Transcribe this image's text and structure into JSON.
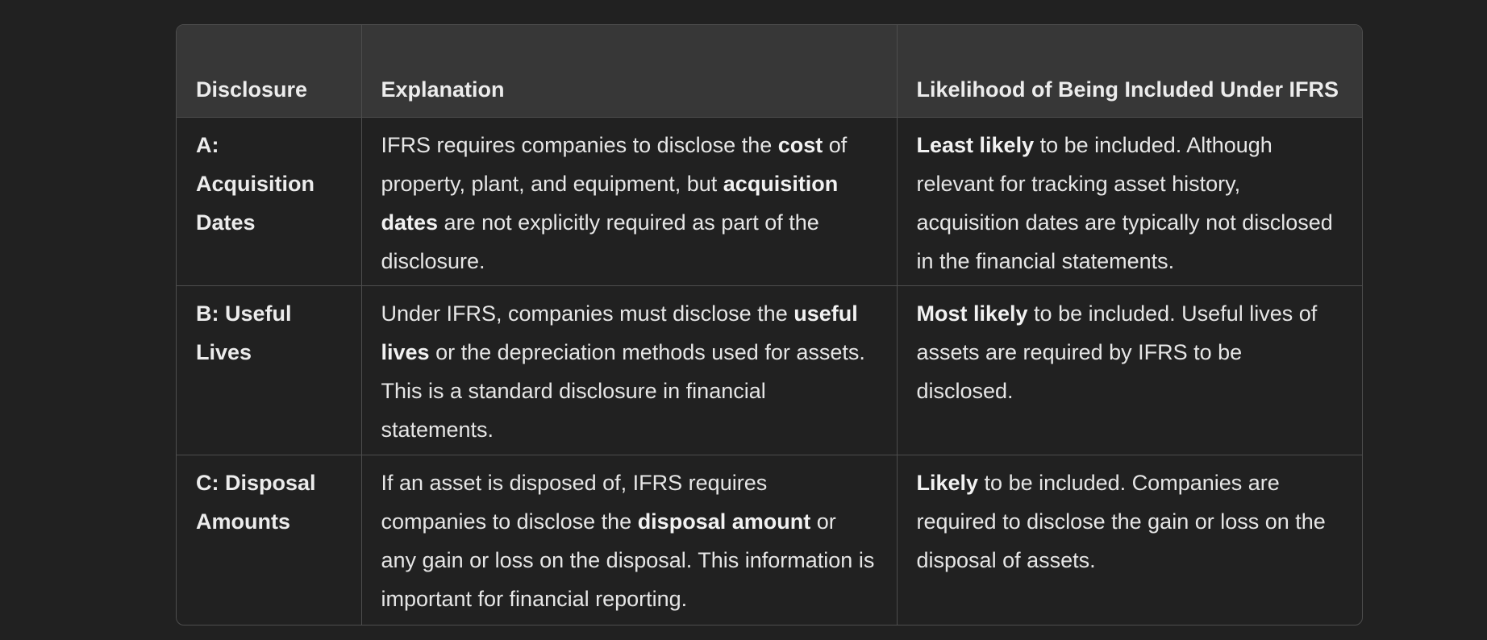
{
  "table": {
    "headers": {
      "disclosure": "Disclosure",
      "explanation": "Explanation",
      "likelihood": "Likelihood of Being Included Under IFRS"
    },
    "rows": [
      {
        "label": "A: Acquisition Dates",
        "explanation": {
          "p1": "IFRS requires companies to disclose the ",
          "b1": "cost",
          "p2": " of property, plant, and equipment, but ",
          "b2": "acquisition dates",
          "p3": " are not explicitly required as part of the disclosure."
        },
        "likelihood": {
          "b1": "Least likely",
          "p1": " to be included. Although relevant for tracking asset history, acquisition dates are typically not disclosed in the financial statements."
        }
      },
      {
        "label": "B: Useful Lives",
        "explanation": {
          "p1": "Under IFRS, companies must disclose the ",
          "b1": "useful lives",
          "p2": " or the depreciation methods used for assets. This is a standard disclosure in financial statements."
        },
        "likelihood": {
          "b1": "Most likely",
          "p1": " to be included. Useful lives of assets are required by IFRS to be disclosed."
        }
      },
      {
        "label": "C: Disposal Amounts",
        "explanation": {
          "p1": "If an asset is disposed of, IFRS requires companies to disclose the ",
          "b1": "disposal amount",
          "p2": " or any gain or loss on the disposal. This information is important for financial reporting."
        },
        "likelihood": {
          "b1": "Likely",
          "p1": " to be included. Companies are required to disclose the gain or loss on the disposal of assets."
        }
      }
    ]
  }
}
